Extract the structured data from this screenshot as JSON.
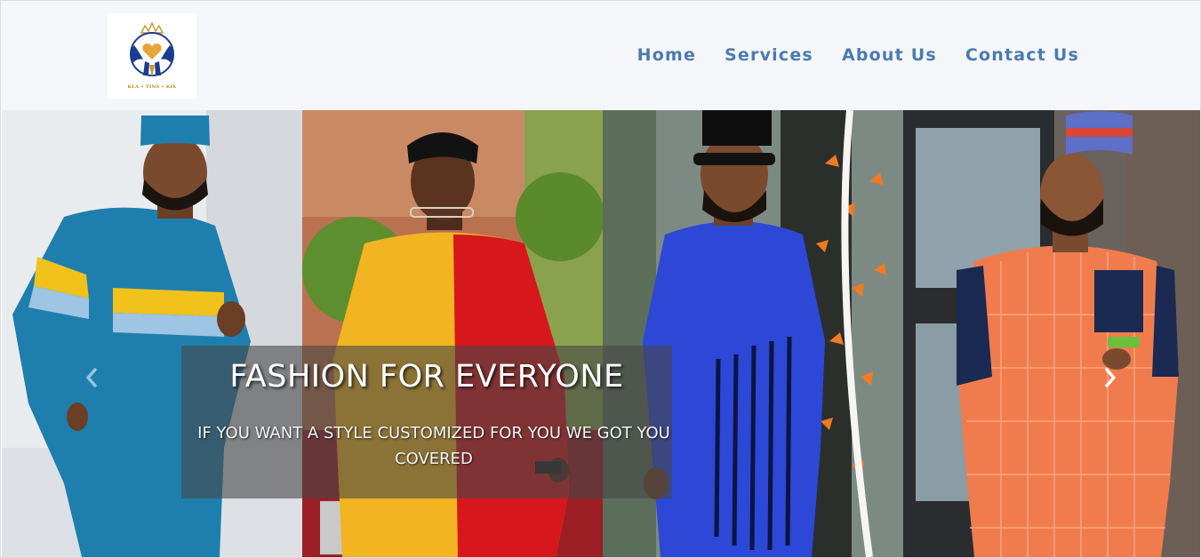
{
  "header": {
    "logo_text": "KLA • TINS • KIX",
    "nav": [
      {
        "label": "Home"
      },
      {
        "label": "Services"
      },
      {
        "label": "About Us"
      },
      {
        "label": "Contact Us"
      }
    ]
  },
  "hero": {
    "title": "FASHION FOR EVERYONE",
    "subtitle": "IF YOU WANT A STYLE CUSTOMIZED FOR YOU WE GOT YOU COVERED",
    "prev_icon": "chevron-left-icon",
    "next_icon": "chevron-right-icon"
  },
  "colors": {
    "nav_text": "#4a7bb1",
    "header_bg": "#f4f6f9",
    "overlay": "#464646"
  }
}
